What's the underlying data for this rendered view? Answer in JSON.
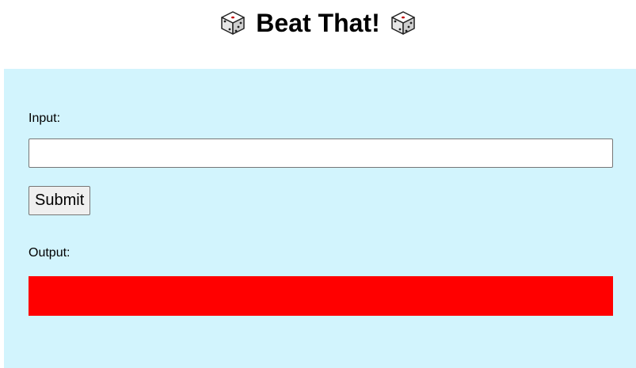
{
  "header": {
    "title": "Beat That!",
    "left_icon": "dice-icon",
    "right_icon": "dice-icon"
  },
  "form": {
    "input_label": "Input:",
    "input_value": "",
    "input_placeholder": "",
    "submit_label": "Submit",
    "output_label": "Output:",
    "output_text": ""
  },
  "colors": {
    "panel_background": "#d2f4fd",
    "output_background": "#ff0000"
  }
}
